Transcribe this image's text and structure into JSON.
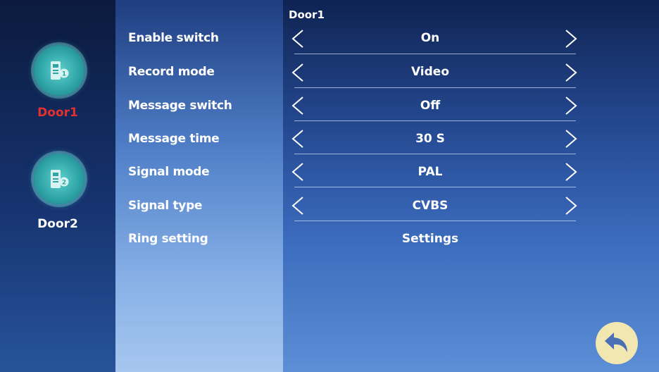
{
  "title": "Door1",
  "doors": [
    {
      "name": "Door1",
      "number": "1",
      "selected": true,
      "color": "#e53030",
      "icon": "door-phone-1-icon"
    },
    {
      "name": "Door2",
      "number": "2",
      "selected": false,
      "color": "#ffffff",
      "icon": "door-phone-2-icon"
    }
  ],
  "settings": [
    {
      "label": "Enable switch",
      "value": "On"
    },
    {
      "label": "Record mode",
      "value": "Video"
    },
    {
      "label": "Message switch",
      "value": "Off"
    },
    {
      "label": "Message time",
      "value": "30 S"
    },
    {
      "label": "Signal mode",
      "value": "PAL"
    },
    {
      "label": "Signal type",
      "value": "CVBS"
    },
    {
      "label": "Ring setting",
      "value": "Settings"
    }
  ],
  "icons": {
    "prev": "chevron-left-icon",
    "next": "chevron-right-icon",
    "back": "return-arrow-icon"
  },
  "colors": {
    "accent_selected": "#e53030",
    "door_icon": "#3fb8b5",
    "back_button": "#f3e7b1"
  }
}
